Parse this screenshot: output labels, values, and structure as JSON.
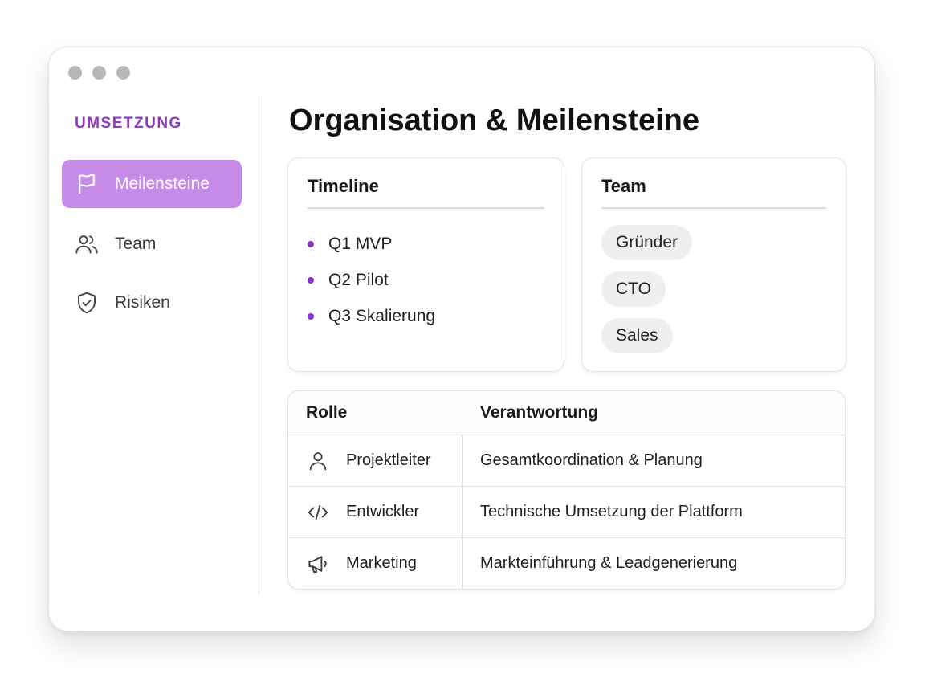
{
  "sidebar": {
    "section_label": "UMSETZUNG",
    "items": [
      {
        "label": "Meilensteine",
        "icon": "flag-icon",
        "active": true
      },
      {
        "label": "Team",
        "icon": "users-icon",
        "active": false
      },
      {
        "label": "Risiken",
        "icon": "shield-check-icon",
        "active": false
      }
    ]
  },
  "main": {
    "title": "Organisation & Meilensteine",
    "timeline": {
      "title": "Timeline",
      "items": [
        "Q1 MVP",
        "Q2 Pilot",
        "Q3 Skalierung"
      ]
    },
    "team": {
      "title": "Team",
      "chips": [
        "Gründer",
        "CTO",
        "Sales"
      ]
    },
    "table": {
      "headers": [
        "Rolle",
        "Verantwortung"
      ],
      "rows": [
        {
          "icon": "user-icon",
          "role": "Projektleiter",
          "responsibility": "Gesamtkoordination & Planung"
        },
        {
          "icon": "code-icon",
          "role": "Entwickler",
          "responsibility": "Technische Umsetzung der Plattform"
        },
        {
          "icon": "megaphone-icon",
          "role": "Marketing",
          "responsibility": "Markteinführung & Leadgenerierung"
        }
      ]
    }
  },
  "colors": {
    "accent": "#9137c4",
    "active_nav_bg": "#c68be6",
    "bullet": "#8e2fc8"
  }
}
